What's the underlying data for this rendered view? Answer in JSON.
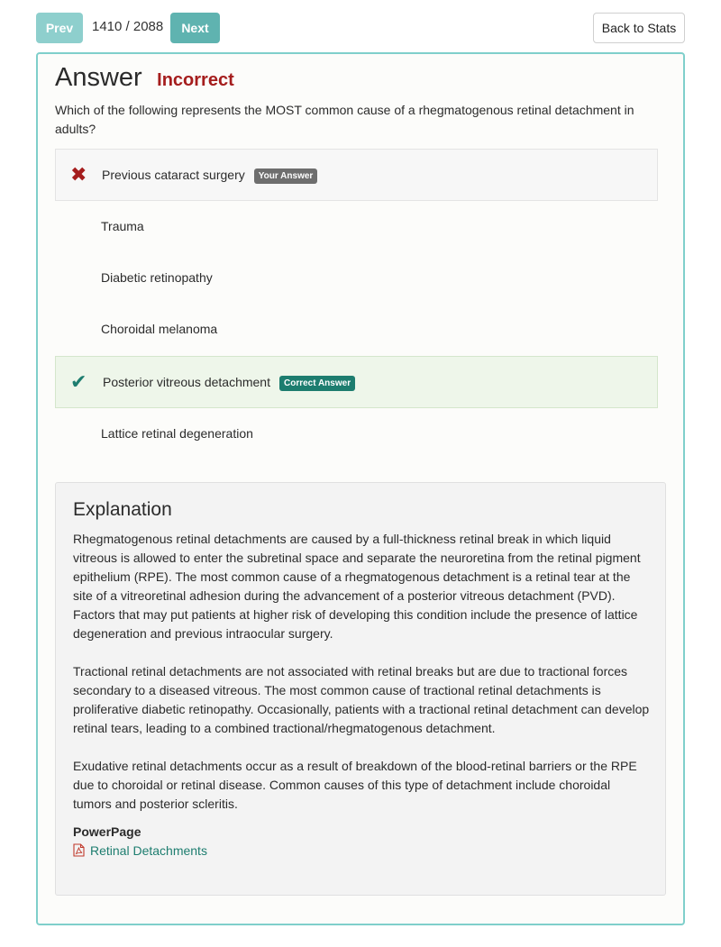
{
  "nav": {
    "prev_label": "Prev",
    "counter": "1410 / 2088",
    "next_label": "Next",
    "back_label": "Back to Stats"
  },
  "answer": {
    "title": "Answer",
    "status": "Incorrect",
    "question": "Which of the following represents the MOST common cause of a rhegmatogenous retinal detachment in adults?",
    "options": [
      {
        "label": "Previous cataract surgery",
        "state": "your-answer",
        "badge": "Your Answer"
      },
      {
        "label": "Trauma",
        "state": "none"
      },
      {
        "label": "Diabetic retinopathy",
        "state": "none"
      },
      {
        "label": "Choroidal melanoma",
        "state": "none"
      },
      {
        "label": "Posterior vitreous detachment",
        "state": "correct",
        "badge": "Correct Answer"
      },
      {
        "label": "Lattice retinal degeneration",
        "state": "none"
      }
    ],
    "icons": {
      "wrong": "x-mark-icon",
      "correct": "checkmark-icon"
    }
  },
  "explanation": {
    "title": "Explanation",
    "paragraphs": [
      "Rhegmatogenous retinal detachments are caused by a full-thickness retinal break in which liquid vitreous is allowed to enter the subretinal space and separate the neuroretina from the retinal pigment epithelium (RPE). The most common cause of a rhegmatogenous detachment is a retinal tear at the site of a vitreoretinal adhesion during the advancement of a posterior vitreous detachment (PVD). Factors that may put patients at higher risk of developing this condition include the presence of lattice degeneration and previous intraocular surgery.",
      "Tractional retinal detachments are not associated with retinal breaks but are due to tractional forces secondary to a diseased vitreous. The most common cause of tractional retinal detachments is proliferative diabetic retinopathy. Occasionally, patients with a tractional retinal detachment can develop retinal tears, leading to a combined tractional/rhegmatogenous detachment.",
      "Exudative retinal detachments occur as a result of breakdown of the blood-retinal barriers or the RPE due to choroidal or retinal disease. Common causes of this type of detachment include choroidal tumors and posterior scleritis."
    ],
    "powerpage_label": "PowerPage",
    "powerpage_link": "Retinal Detachments",
    "powerpage_icon": "pdf-file-icon"
  },
  "colors": {
    "teal": "#5fb3b0",
    "teal_light": "#8ecfcd",
    "incorrect_red": "#a51d1d",
    "correct_green": "#1d7d6f",
    "card_border": "#7fcfcb"
  }
}
